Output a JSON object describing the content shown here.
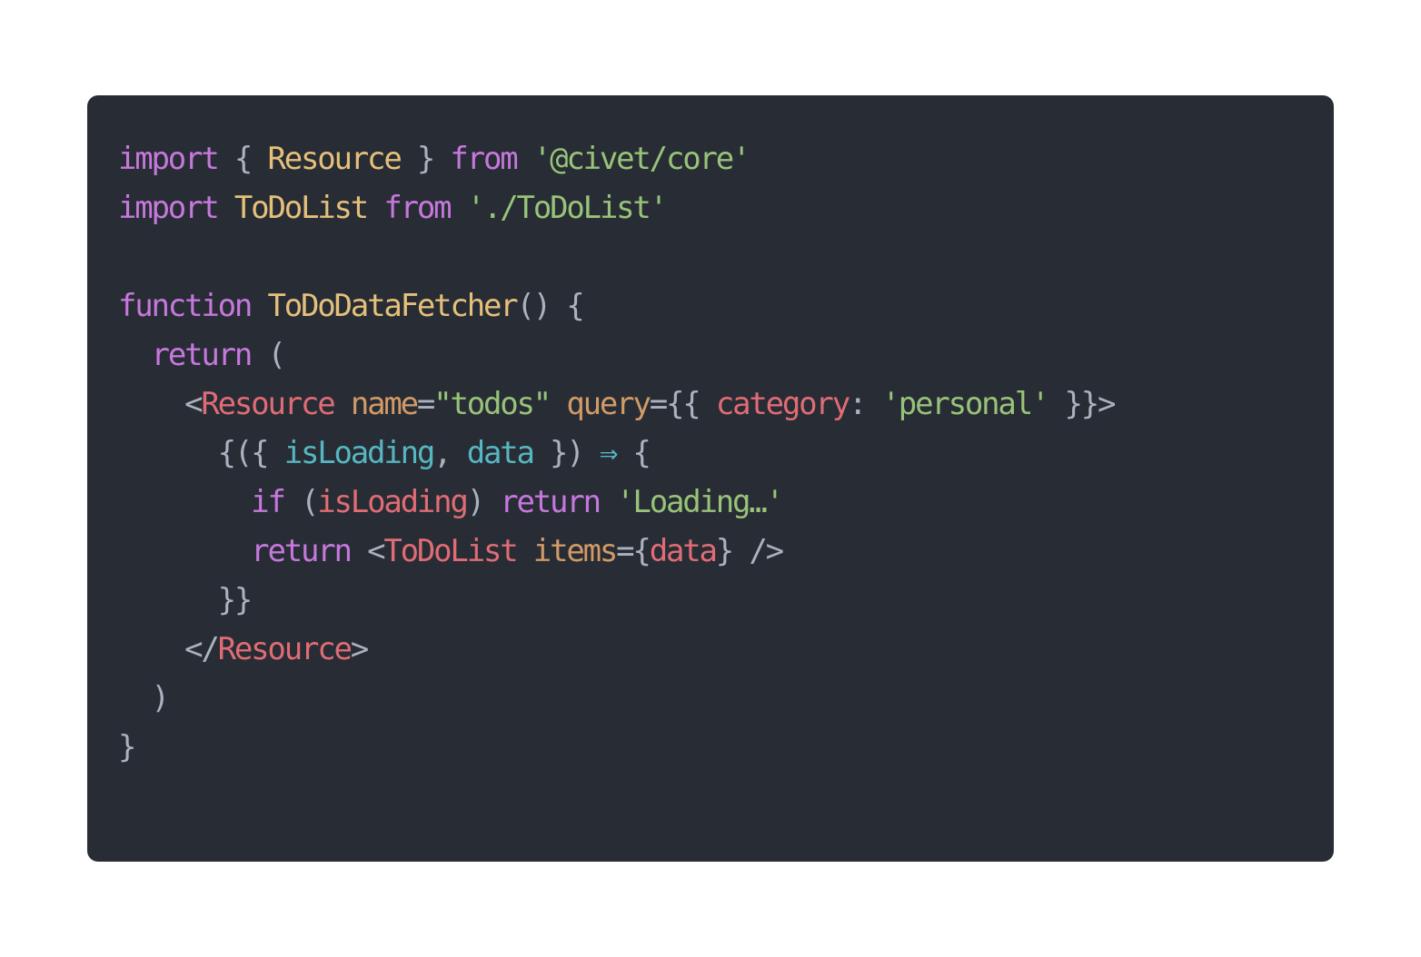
{
  "code_block": {
    "language": "jsx",
    "lines": [
      [
        [
          "keyword",
          "import"
        ],
        [
          "plain",
          " { "
        ],
        [
          "class",
          "Resource"
        ],
        [
          "plain",
          " } "
        ],
        [
          "keyword",
          "from"
        ],
        [
          "plain",
          " "
        ],
        [
          "string",
          "'@civet/core'"
        ]
      ],
      [
        [
          "keyword",
          "import"
        ],
        [
          "plain",
          " "
        ],
        [
          "class",
          "ToDoList"
        ],
        [
          "plain",
          " "
        ],
        [
          "keyword",
          "from"
        ],
        [
          "plain",
          " "
        ],
        [
          "string",
          "'./ToDoList'"
        ]
      ],
      [],
      [
        [
          "keyword",
          "function"
        ],
        [
          "plain",
          " "
        ],
        [
          "class",
          "ToDoDataFetcher"
        ],
        [
          "plain",
          "() {"
        ]
      ],
      [
        [
          "plain",
          "  "
        ],
        [
          "keyword",
          "return"
        ],
        [
          "plain",
          " ("
        ]
      ],
      [
        [
          "plain",
          "    <"
        ],
        [
          "tag",
          "Resource"
        ],
        [
          "plain",
          " "
        ],
        [
          "attr",
          "name"
        ],
        [
          "plain",
          "="
        ],
        [
          "string",
          "\"todos\""
        ],
        [
          "plain",
          " "
        ],
        [
          "attr",
          "query"
        ],
        [
          "plain",
          "={{ "
        ],
        [
          "prop",
          "category"
        ],
        [
          "plain",
          ": "
        ],
        [
          "string",
          "'personal'"
        ],
        [
          "plain",
          " }}>"
        ]
      ],
      [
        [
          "plain",
          "      {({ "
        ],
        [
          "param",
          "isLoading"
        ],
        [
          "plain",
          ", "
        ],
        [
          "param",
          "data"
        ],
        [
          "plain",
          " }) "
        ],
        [
          "op",
          "⇒"
        ],
        [
          "plain",
          " {"
        ]
      ],
      [
        [
          "plain",
          "        "
        ],
        [
          "keyword",
          "if"
        ],
        [
          "plain",
          " ("
        ],
        [
          "var",
          "isLoading"
        ],
        [
          "plain",
          ") "
        ],
        [
          "keyword",
          "return"
        ],
        [
          "plain",
          " "
        ],
        [
          "string",
          "'Loading…'"
        ]
      ],
      [
        [
          "plain",
          "        "
        ],
        [
          "keyword",
          "return"
        ],
        [
          "plain",
          " <"
        ],
        [
          "tag",
          "ToDoList"
        ],
        [
          "plain",
          " "
        ],
        [
          "attr",
          "items"
        ],
        [
          "plain",
          "={"
        ],
        [
          "var",
          "data"
        ],
        [
          "plain",
          "} />"
        ]
      ],
      [
        [
          "plain",
          "      }}"
        ]
      ],
      [
        [
          "plain",
          "    </"
        ],
        [
          "tag",
          "Resource"
        ],
        [
          "plain",
          ">"
        ]
      ],
      [
        [
          "plain",
          "  )"
        ]
      ],
      [
        [
          "plain",
          "}"
        ]
      ]
    ]
  }
}
